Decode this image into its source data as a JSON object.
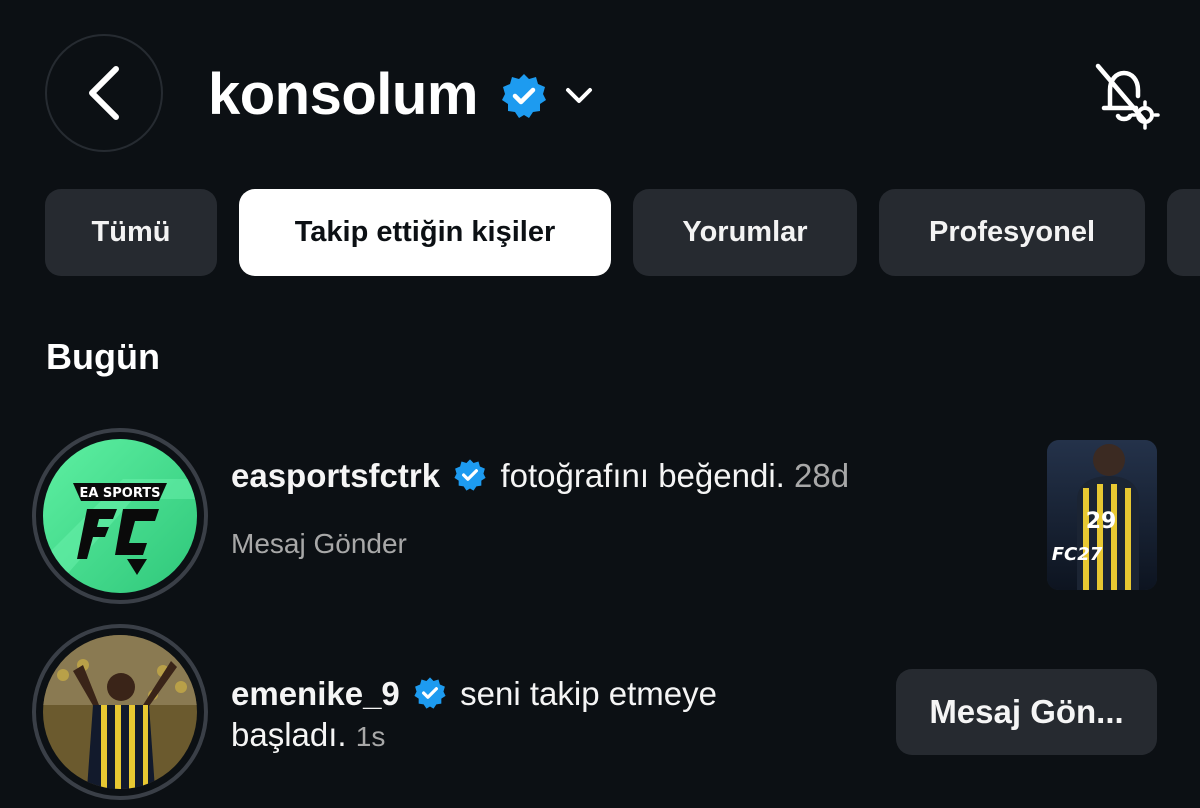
{
  "header": {
    "username": "konsolum"
  },
  "tabs": [
    {
      "label": "Tümü",
      "active": false
    },
    {
      "label": "Takip ettiğin kişiler",
      "active": true
    },
    {
      "label": "Yorumlar",
      "active": false
    },
    {
      "label": "Profesyonel",
      "active": false
    }
  ],
  "section": {
    "title": "Bugün"
  },
  "notifications": [
    {
      "username": "easportsfctrk",
      "text": "fotoğrafını beğendi.",
      "time": "28d",
      "action": "Mesaj Gönder",
      "thumbnail_text": "FC27",
      "avatar_text": "EA SPORTS"
    },
    {
      "username": "emenike_9",
      "text_line1": "seni takip etmeye",
      "text_line2": "başladı.",
      "time": "1s",
      "button": "Mesaj Gön..."
    }
  ],
  "colors": {
    "background": "#0c1014",
    "verified": "#1d9bf0",
    "tab_bg": "#262a30",
    "tab_active_bg": "#ffffff",
    "ea_green": "#45e38f"
  }
}
